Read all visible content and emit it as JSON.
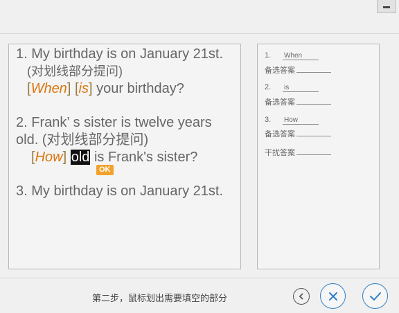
{
  "window": {
    "minimize_icon": "minimize-icon"
  },
  "editor": {
    "q1": {
      "line1": "1. My birthday is on January 21st.",
      "line2": "(对划线部分提问)",
      "answer": {
        "open1": "[",
        "blank1": "When",
        "close1": "]",
        "open2": "[",
        "blank2": "is",
        "close2": "]",
        "rest": " your birthday?"
      }
    },
    "q2": {
      "line1": "2. Frank’  s sister is twelve years",
      "line2": "old. (对划线部分提问)",
      "answer": {
        "open1": "[",
        "blank1": "How",
        "close1": "]",
        "selected": "old",
        "rest": " is Frank's sister?",
        "ok_badge": "OK"
      }
    },
    "q3": {
      "line1": "3. My birthday is on January 21st."
    }
  },
  "answers": {
    "items": [
      {
        "num": "1.",
        "word": "When",
        "label": "备选答案"
      },
      {
        "num": "2.",
        "word": "is",
        "label": "备选答案"
      },
      {
        "num": "3.",
        "word": "How",
        "label": "备选答案"
      }
    ],
    "distractor_label": "干扰答案"
  },
  "footer": {
    "instruction": "第二步，鼠标划出需要填空的部分",
    "back_icon": "chevron-left-icon",
    "cancel_icon": "close-icon",
    "confirm_icon": "check-icon",
    "accent_color": "#2e7fc6"
  }
}
